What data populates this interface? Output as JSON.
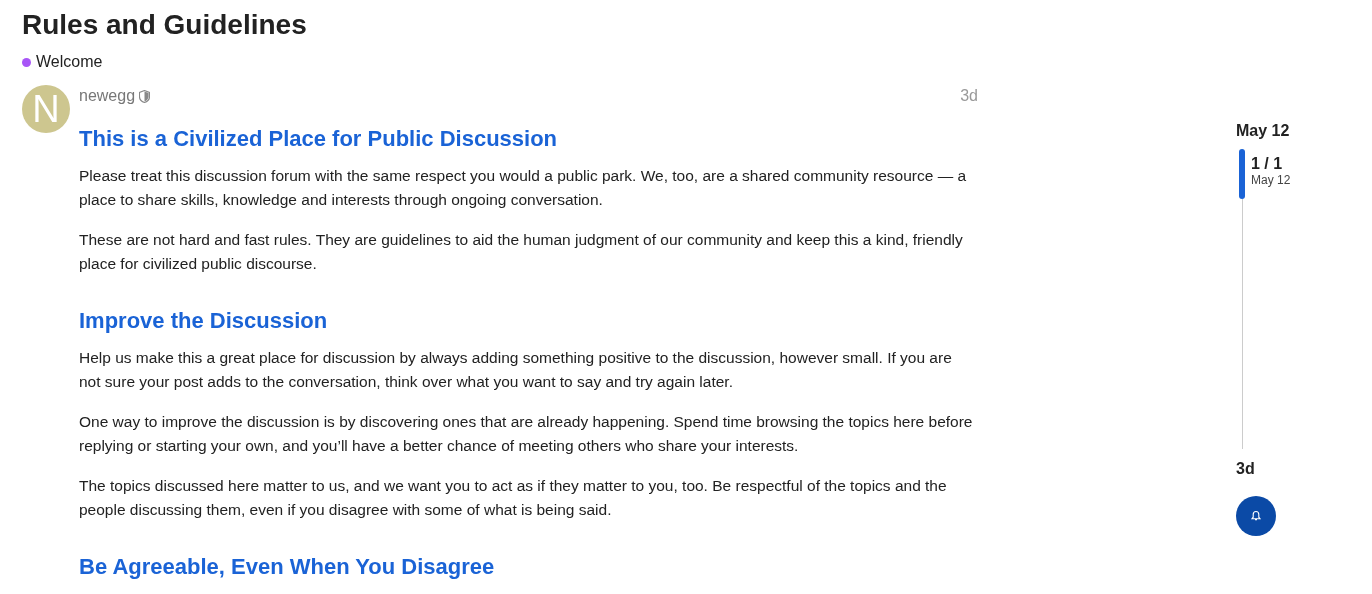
{
  "topic": {
    "title": "Rules and Guidelines",
    "category": {
      "name": "Welcome",
      "color": "#a855f7"
    }
  },
  "post": {
    "avatar_letter": "N",
    "author": "newegg",
    "age": "3d",
    "sections": [
      {
        "heading": "This is a Civilized Place for Public Discussion",
        "paragraphs": [
          "Please treat this discussion forum with the same respect you would a public park. We, too, are a shared community resource — a place to share skills, knowledge and interests through ongoing conversation.",
          "These are not hard and fast rules. They are guidelines to aid the human judgment of our community and keep this a kind, friendly place for civilized public discourse."
        ]
      },
      {
        "heading": "Improve the Discussion",
        "paragraphs": [
          "Help us make this a great place for discussion by always adding something positive to the discussion, however small. If you are not sure your post adds to the conversation, think over what you want to say and try again later.",
          "One way to improve the discussion is by discovering ones that are already happening. Spend time browsing the topics here before replying or starting your own, and you’ll have a better chance of meeting others who share your interests.",
          "The topics discussed here matter to us, and we want you to act as if they matter to you, too. Be respectful of the topics and the people discussing them, even if you disagree with some of what is being said."
        ]
      },
      {
        "heading": "Be Agreeable, Even When You Disagree"
      }
    ]
  },
  "timeline": {
    "start_date": "May 12",
    "position": "1 / 1",
    "position_date": "May 12",
    "end_label": "3d"
  }
}
